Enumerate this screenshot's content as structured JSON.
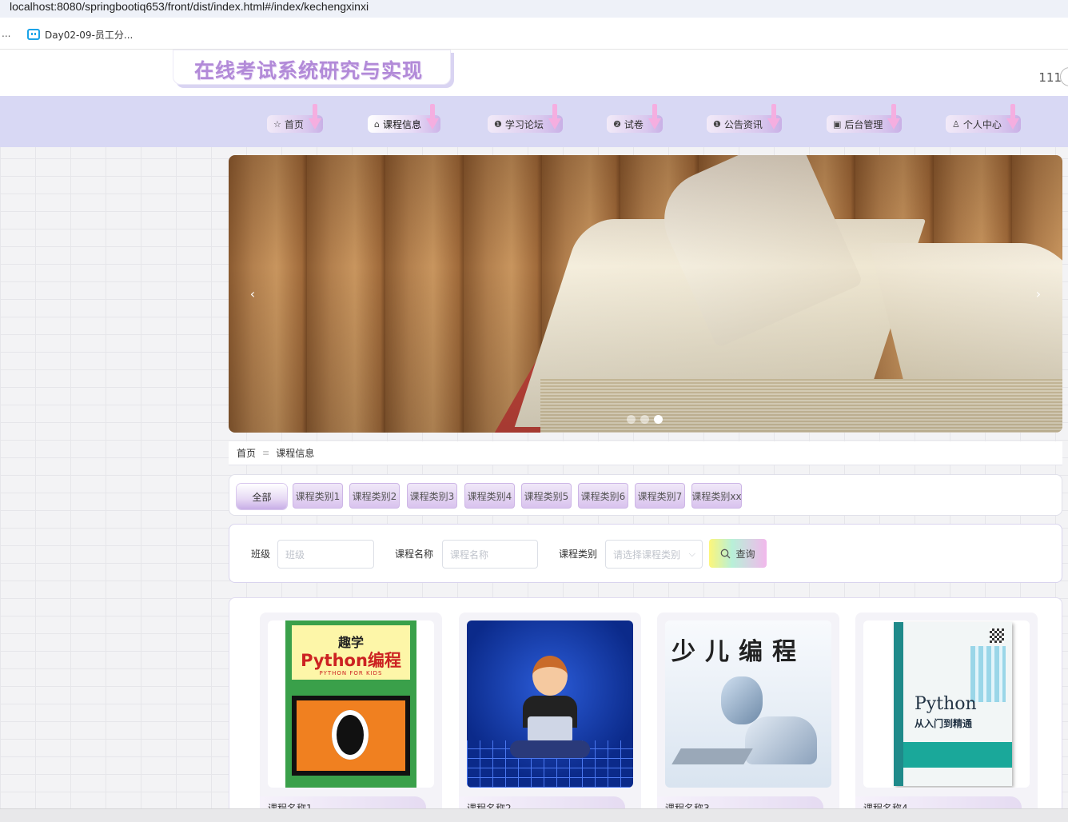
{
  "browser": {
    "url": "localhost:8080/springbootiq653/front/dist/index.html#/index/kechengxinxi",
    "bookmarks_overflow": "...",
    "bookmark_label": "Day02-09-员工分...",
    "bookmark_icon": "bilibili-icon"
  },
  "header": {
    "site_title": "在线考试系统研究与实现",
    "user_name": "111"
  },
  "nav": {
    "items": [
      {
        "label": "首页",
        "icon": "star-icon",
        "glyph": "☆"
      },
      {
        "label": "课程信息",
        "icon": "bag-icon",
        "glyph": "⌂"
      },
      {
        "label": "学习论坛",
        "icon": "info-icon",
        "glyph": "❶"
      },
      {
        "label": "试卷",
        "icon": "question-icon",
        "glyph": "❷"
      },
      {
        "label": "公告资讯",
        "icon": "info-icon",
        "glyph": "❶"
      },
      {
        "label": "后台管理",
        "icon": "monitor-icon",
        "glyph": "▣"
      },
      {
        "label": "个人中心",
        "icon": "user-icon",
        "glyph": "♙"
      }
    ],
    "active_index": 1
  },
  "carousel": {
    "slide_count": 3,
    "active_slide": 3,
    "prev_glyph": "‹",
    "next_glyph": "›"
  },
  "breadcrumb": {
    "home": "首页",
    "separator": "≡",
    "current": "课程信息"
  },
  "categories": {
    "all_label": "全部",
    "items": [
      "课程类别1",
      "课程类别2",
      "课程类别3",
      "课程类别4",
      "课程类别5",
      "课程类别6",
      "课程类别7",
      "课程类别xx"
    ]
  },
  "search": {
    "class_label": "班级",
    "class_placeholder": "班级",
    "course_name_label": "课程名称",
    "course_name_placeholder": "课程名称",
    "category_label": "课程类别",
    "category_placeholder": "请选择课程类别",
    "button_label": "查询",
    "button_icon": "search-icon"
  },
  "courses": [
    {
      "name": "课程名称1",
      "cover_title": "趣学",
      "cover_subtitle": "Python编程",
      "cover_tag": "PYTHON FOR KIDS"
    },
    {
      "name": "课程名称2"
    },
    {
      "name": "课程名称3",
      "cover_title": "少儿编程"
    },
    {
      "name": "课程名称4",
      "cover_title": "Python",
      "cover_subtitle": "从入门到精通"
    }
  ],
  "colors": {
    "nav_band": "#d8d8f4",
    "title_purple": "#b28ad8",
    "accent_pink": "#f5aee0"
  }
}
